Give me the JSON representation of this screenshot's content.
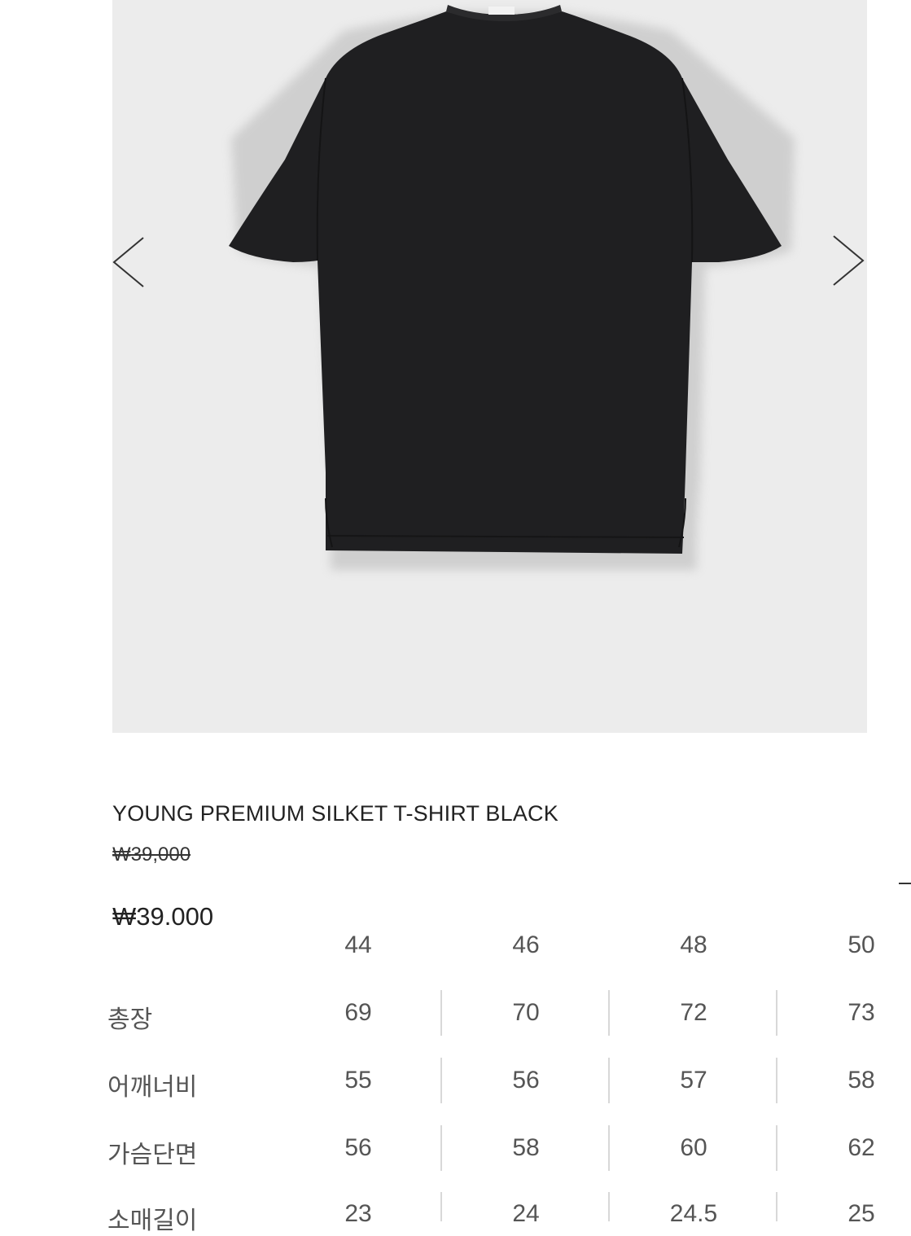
{
  "gallery": {
    "image_alt": "black t-shirt",
    "background": "#ececec",
    "shirt_color": "#1f1f21",
    "prev_icon": "chevron-left-icon",
    "next_icon": "chevron-right-icon"
  },
  "product": {
    "name": "YOUNG PREMIUM SILKET T-SHIRT BLACK",
    "original_price": "₩39,000",
    "sale_price": "₩39.000"
  },
  "size_table": {
    "sizes": [
      "44",
      "46",
      "48",
      "50"
    ],
    "rows": [
      {
        "label": "총장",
        "values": [
          "69",
          "70",
          "72",
          "73"
        ]
      },
      {
        "label": "어깨너비",
        "values": [
          "55",
          "56",
          "57",
          "58"
        ]
      },
      {
        "label": "가슴단면",
        "values": [
          "56",
          "58",
          "60",
          "62"
        ]
      },
      {
        "label": "소매길이",
        "values": [
          "23",
          "24",
          "24.5",
          "25"
        ]
      }
    ]
  }
}
